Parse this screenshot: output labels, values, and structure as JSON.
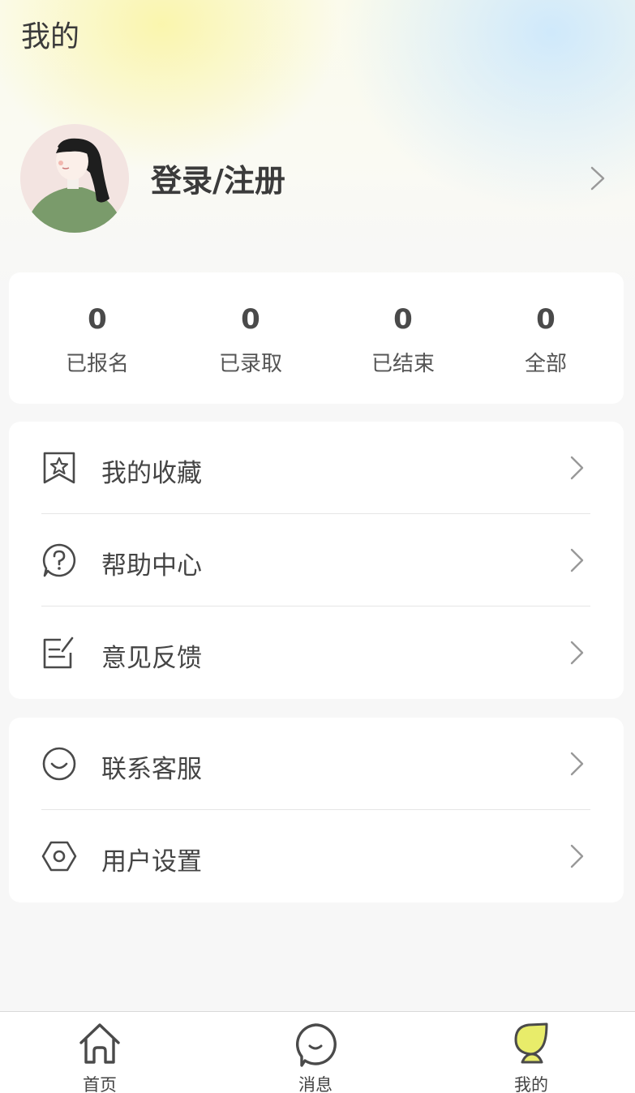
{
  "header": {
    "title": "我的"
  },
  "profile": {
    "login_label": "登录/注册",
    "avatar_icon": "avatar-illustration",
    "arrow_icon": "chevron-right-icon"
  },
  "stats": [
    {
      "value": "0",
      "label": "已报名"
    },
    {
      "value": "0",
      "label": "已录取"
    },
    {
      "value": "0",
      "label": "已结束"
    },
    {
      "value": "0",
      "label": "全部"
    }
  ],
  "menu_group_1": [
    {
      "label": "我的收藏",
      "icon": "favorites-star-icon"
    },
    {
      "label": "帮助中心",
      "icon": "help-question-icon"
    },
    {
      "label": "意见反馈",
      "icon": "feedback-edit-icon"
    }
  ],
  "menu_group_2": [
    {
      "label": "联系客服",
      "icon": "customer-service-smile-icon"
    },
    {
      "label": "用户设置",
      "icon": "settings-hexagon-icon"
    }
  ],
  "tabbar": {
    "items": [
      {
        "label": "首页",
        "icon": "home-icon"
      },
      {
        "label": "消息",
        "icon": "message-smile-icon"
      },
      {
        "label": "我的",
        "icon": "profile-leaf-icon",
        "active": true
      }
    ]
  },
  "colors": {
    "active_tab": "#e8ec6a",
    "icon_stroke": "#4a4a4a",
    "avatar_shirt": "#7a9b6b"
  }
}
